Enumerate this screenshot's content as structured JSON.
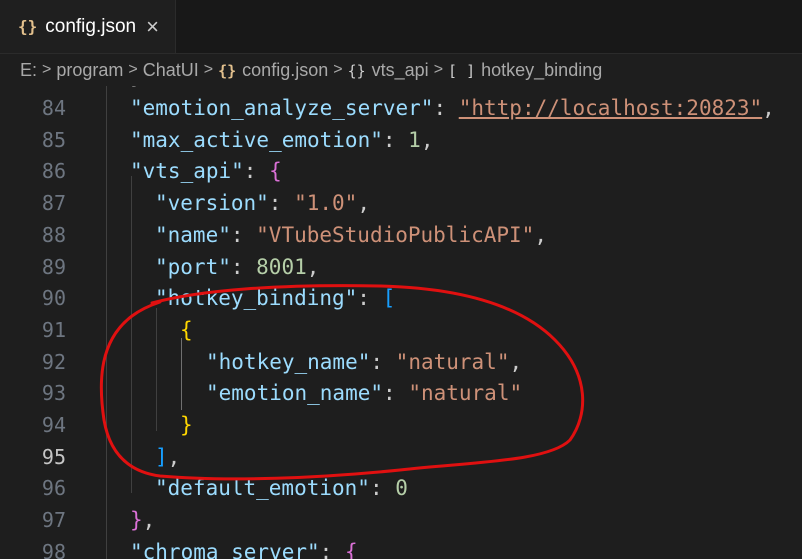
{
  "tab": {
    "label": "config.json",
    "icon": "{}",
    "close": "×"
  },
  "breadcrumb": {
    "items": [
      {
        "label": "E:"
      },
      {
        "label": "program"
      },
      {
        "label": "ChatUI"
      },
      {
        "label": "config.json",
        "icon": "{}"
      },
      {
        "label": "vts_api",
        "icon": "{}"
      },
      {
        "label": "hotkey_binding",
        "icon": "[ ]"
      }
    ],
    "separator": ">"
  },
  "partial_line": "},",
  "lines": [
    {
      "num": "84",
      "key": "\"emotion_analyze_server\"",
      "colon": ": ",
      "str": "\"http://localhost:20823\"",
      "end": ","
    },
    {
      "num": "85",
      "key": "\"max_active_emotion\"",
      "colon": ": ",
      "numval": "1",
      "end": ","
    },
    {
      "num": "86",
      "key": "\"vts_api\"",
      "colon": ": ",
      "open": "{"
    },
    {
      "num": "87",
      "key": "\"version\"",
      "colon": ": ",
      "str": "\"1.0\"",
      "end": ","
    },
    {
      "num": "88",
      "key": "\"name\"",
      "colon": ": ",
      "str": "\"VTubeStudioPublicAPI\"",
      "end": ","
    },
    {
      "num": "89",
      "key": "\"port\"",
      "colon": ": ",
      "numval": "8001",
      "end": ","
    },
    {
      "num": "90",
      "key": "\"hotkey_binding\"",
      "colon": ": ",
      "open": "["
    },
    {
      "num": "91",
      "open": "{"
    },
    {
      "num": "92",
      "key": "\"hotkey_name\"",
      "colon": ": ",
      "str": "\"natural\"",
      "end": ","
    },
    {
      "num": "93",
      "key": "\"emotion_name\"",
      "colon": ": ",
      "str": "\"natural\""
    },
    {
      "num": "94",
      "close": "}"
    },
    {
      "num": "95",
      "close": "]",
      "end": ","
    },
    {
      "num": "96",
      "key": "\"default_emotion\"",
      "colon": ": ",
      "numval": "0"
    },
    {
      "num": "97",
      "close": "}",
      "end": ","
    },
    {
      "num": "98",
      "key": "\"chroma_server\"",
      "colon": ": ",
      "open": "{"
    }
  ],
  "colors": {
    "key": "#9cdcfe",
    "string": "#ce9178",
    "number": "#b5cea8",
    "bracket_level1": "#da70d6",
    "bracket_level2": "#179fff",
    "bracket_level3": "#ffd700",
    "annotation": "#e01010"
  }
}
